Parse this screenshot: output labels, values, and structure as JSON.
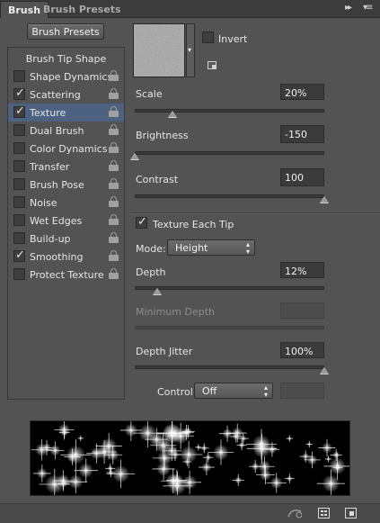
{
  "tabs": [
    {
      "label": "Brush"
    },
    {
      "label": "Brush Presets"
    }
  ],
  "brush_presets_button": "Brush Presets",
  "left_list": {
    "header": "Brush Tip Shape",
    "items": [
      {
        "label": "Shape Dynamics",
        "checked": false,
        "selected": false
      },
      {
        "label": "Scattering",
        "checked": true,
        "selected": false
      },
      {
        "label": "Texture",
        "checked": true,
        "selected": true
      },
      {
        "label": "Dual Brush",
        "checked": false,
        "selected": false
      },
      {
        "label": "Color Dynamics",
        "checked": false,
        "selected": false
      },
      {
        "label": "Transfer",
        "checked": false,
        "selected": false
      },
      {
        "label": "Brush Pose",
        "checked": false,
        "selected": false
      },
      {
        "label": "Noise",
        "checked": false,
        "selected": false
      },
      {
        "label": "Wet Edges",
        "checked": false,
        "selected": false
      },
      {
        "label": "Build-up",
        "checked": false,
        "selected": false
      },
      {
        "label": "Smoothing",
        "checked": true,
        "selected": false
      },
      {
        "label": "Protect Texture",
        "checked": false,
        "selected": false
      }
    ]
  },
  "texture": {
    "invert_label": "Invert",
    "invert_checked": false,
    "scale": {
      "label": "Scale",
      "value": "20%",
      "level": 0.2
    },
    "brightness": {
      "label": "Brightness",
      "value": "-150",
      "level": 0.0
    },
    "contrast": {
      "label": "Contrast",
      "value": "100",
      "level": 1.0
    },
    "texture_each_tip": {
      "label": "Texture Each Tip",
      "checked": true
    },
    "mode": {
      "label": "Mode:",
      "value": "Height"
    },
    "depth": {
      "label": "Depth",
      "value": "12%",
      "level": 0.12
    },
    "minimum_depth": {
      "label": "Minimum Depth",
      "value": "",
      "level": 1.0
    },
    "depth_jitter": {
      "label": "Depth Jitter",
      "value": "100%",
      "level": 1.0
    },
    "control": {
      "label": "Control:",
      "value": "Off"
    }
  },
  "icons": {
    "check": "✓",
    "dropdown_arrow": "▾",
    "updown": "▴▾",
    "collapse": "▸▸",
    "menu": "▾≡"
  }
}
